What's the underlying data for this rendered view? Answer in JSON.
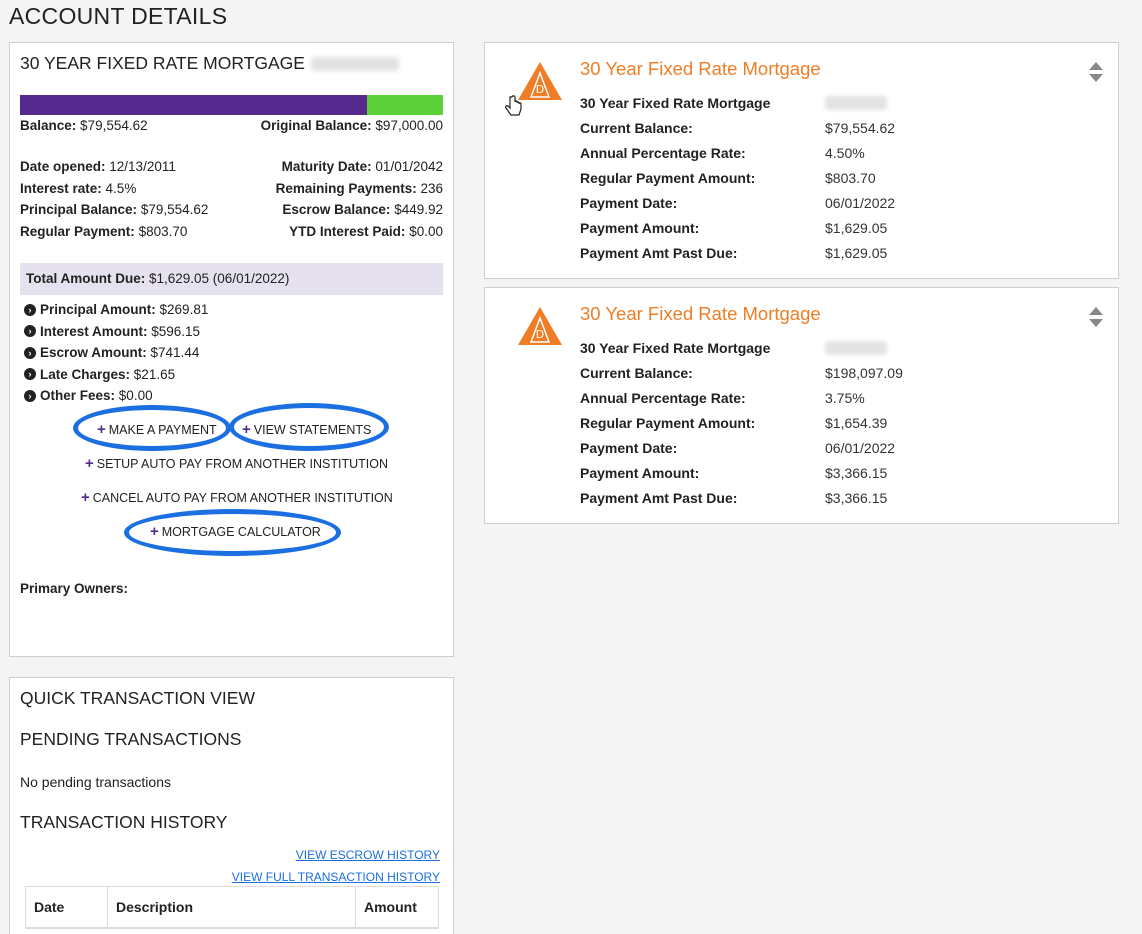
{
  "page": {
    "title": "ACCOUNT DETAILS"
  },
  "account": {
    "title": "30 YEAR FIXED RATE MORTGAGE",
    "progress_fraction": 0.82,
    "balance_label": "Balance:",
    "balance_value": "$79,554.62",
    "original_label": "Original Balance:",
    "original_value": "$97,000.00",
    "left_fields": [
      {
        "label": "Date opened:",
        "value": "12/13/2011"
      },
      {
        "label": "Interest rate:",
        "value": "4.5%"
      },
      {
        "label": "Principal Balance:",
        "value": "$79,554.62"
      },
      {
        "label": "Regular Payment:",
        "value": "$803.70"
      }
    ],
    "right_fields": [
      {
        "label": "Maturity Date:",
        "value": "01/01/2042"
      },
      {
        "label": "Remaining Payments:",
        "value": "236"
      },
      {
        "label": "Escrow Balance:",
        "value": "$449.92"
      },
      {
        "label": "YTD Interest Paid:",
        "value": "$0.00"
      }
    ],
    "total_due_label": "Total Amount Due:",
    "total_due_value": "$1,629.05 (06/01/2022)",
    "due_items": [
      {
        "label": "Principal Amount:",
        "value": "$269.81"
      },
      {
        "label": "Interest Amount:",
        "value": "$596.15"
      },
      {
        "label": "Escrow Amount:",
        "value": "$741.44"
      },
      {
        "label": "Late Charges:",
        "value": "$21.65"
      },
      {
        "label": "Other Fees:",
        "value": "$0.00"
      }
    ],
    "actions": {
      "make_payment": "MAKE A PAYMENT",
      "view_statements": "VIEW STATEMENTS",
      "setup_autopay": "SETUP AUTO PAY FROM ANOTHER INSTITUTION",
      "cancel_autopay": "CANCEL AUTO PAY FROM ANOTHER INSTITUTION",
      "calculator": "MORTGAGE CALCULATOR"
    },
    "owners_label": "Primary Owners:"
  },
  "quick": {
    "title": "QUICK TRANSACTION VIEW",
    "pending_title": "PENDING TRANSACTIONS",
    "pending_empty": "No pending transactions",
    "history_title": "TRANSACTION HISTORY",
    "escrow_link": "VIEW ESCROW HISTORY",
    "full_link": "VIEW FULL TRANSACTION HISTORY",
    "columns": [
      "Date",
      "Description",
      "Amount"
    ]
  },
  "cards": [
    {
      "title": "30 Year Fixed Rate Mortgage",
      "rows": [
        {
          "label": "30 Year Fixed Rate Mortgage",
          "value": ""
        },
        {
          "label": "Current Balance:",
          "value": "$79,554.62"
        },
        {
          "label": "Annual Percentage Rate:",
          "value": "4.50%"
        },
        {
          "label": "Regular Payment Amount:",
          "value": "$803.70"
        },
        {
          "label": "Payment Date:",
          "value": "06/01/2022"
        },
        {
          "label": "Payment Amount:",
          "value": "$1,629.05"
        },
        {
          "label": "Payment Amt Past Due:",
          "value": "$1,629.05"
        }
      ]
    },
    {
      "title": "30 Year Fixed Rate Mortgage",
      "rows": [
        {
          "label": "30 Year Fixed Rate Mortgage",
          "value": ""
        },
        {
          "label": "Current Balance:",
          "value": "$198,097.09"
        },
        {
          "label": "Annual Percentage Rate:",
          "value": "3.75%"
        },
        {
          "label": "Regular Payment Amount:",
          "value": "$1,654.39"
        },
        {
          "label": "Payment Date:",
          "value": "06/01/2022"
        },
        {
          "label": "Payment Amount:",
          "value": "$3,366.15"
        },
        {
          "label": "Payment Amt Past Due:",
          "value": "$3,366.15"
        }
      ]
    }
  ],
  "colors": {
    "brand_purple": "#552a8f",
    "progress_green": "#5cd13a",
    "accent_orange": "#ef7d26",
    "highlight_blue": "#1b6fe0"
  }
}
